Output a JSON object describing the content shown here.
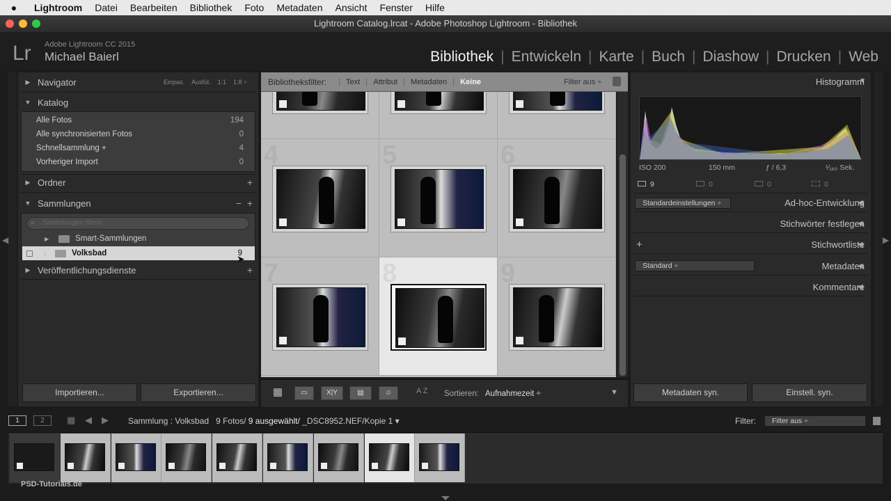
{
  "menubar": {
    "apple": "",
    "items": [
      "Lightroom",
      "Datei",
      "Bearbeiten",
      "Bibliothek",
      "Foto",
      "Metadaten",
      "Ansicht",
      "Fenster",
      "Hilfe"
    ]
  },
  "window": {
    "title": "Lightroom Catalog.lrcat - Adobe Photoshop Lightroom - Bibliothek"
  },
  "identity": {
    "logo": "Lr",
    "product": "Adobe Lightroom CC 2015",
    "user": "Michael Baierl"
  },
  "modules": [
    "Bibliothek",
    "Entwickeln",
    "Karte",
    "Buch",
    "Diashow",
    "Drucken",
    "Web"
  ],
  "navigator": {
    "label": "Navigator",
    "options": [
      "Einpas.",
      "Ausfül.",
      "1:1",
      "1:8 ÷"
    ]
  },
  "katalog": {
    "label": "Katalog",
    "items": [
      {
        "label": "Alle Fotos",
        "count": "194"
      },
      {
        "label": "Alle synchronisierten Fotos",
        "count": "0"
      },
      {
        "label": "Schnellsammlung +",
        "count": "4"
      },
      {
        "label": "Vorheriger Import",
        "count": "0"
      }
    ]
  },
  "ordner": {
    "label": "Ordner",
    "plus": "+"
  },
  "sammlungen": {
    "label": "Sammlungen",
    "minus": "−",
    "plus": "+",
    "search_placeholder": "Sammlungen filtern",
    "items": [
      {
        "label": "Smart-Sammlungen",
        "count": ""
      },
      {
        "label": "Volksbad",
        "count": "9"
      }
    ]
  },
  "veroeffentlichung": {
    "label": "Veröffentlichungsdienste",
    "plus": "+"
  },
  "left_buttons": {
    "import": "Importieren...",
    "export": "Exportieren..."
  },
  "filterbar": {
    "label": "Bibliotheksfilter:",
    "options": [
      "Text",
      "Attribut",
      "Metadaten",
      "Keine"
    ],
    "active": "Keine",
    "filter_preset": "Filter aus ÷"
  },
  "grid": {
    "cells": [
      {
        "num": "",
        "selected": false
      },
      {
        "num": "",
        "selected": false
      },
      {
        "num": "",
        "selected": false
      },
      {
        "num": "4",
        "selected": false
      },
      {
        "num": "5",
        "selected": false
      },
      {
        "num": "6",
        "selected": false
      },
      {
        "num": "7",
        "selected": false
      },
      {
        "num": "8",
        "selected": true
      },
      {
        "num": "9",
        "selected": false
      }
    ]
  },
  "toolbar": {
    "sort_label": "Sortieren:",
    "sort_value": "Aufnahmezeit ÷",
    "az": "A Z",
    "xy": "X|Y"
  },
  "histogram": {
    "label": "Histogramm",
    "iso": "ISO 200",
    "focal": "150 mm",
    "aperture": "ƒ / 6,3",
    "shutter": "¹⁄₁₆₀ Sek.",
    "counts": [
      "9",
      "0",
      "0",
      "0"
    ]
  },
  "adhoc": {
    "preset": "Standardeinstellungen ÷",
    "label": "Ad-hoc-Entwicklung"
  },
  "stichwoerter": {
    "label": "Stichwörter festlegen"
  },
  "stichwortliste": {
    "label": "Stichwortliste",
    "plus": "+"
  },
  "metadaten": {
    "preset": "Standard ÷",
    "label": "Metadaten"
  },
  "kommentare": {
    "label": "Kommentare"
  },
  "right_buttons": {
    "meta_sync": "Metadaten syn.",
    "settings_sync": "Einstell. syn."
  },
  "statusbar": {
    "screen1": "1",
    "screen2": "2",
    "source": "Sammlung : Volksbad",
    "count": "9 Fotos/",
    "selected": "9 ausgewählt/",
    "file": "_DSC8952.NEF/Kopie 1 ▾",
    "filter_label": "Filter:",
    "filter_value": "Filter aus ÷"
  },
  "filmstrip": {
    "selected_index": 7,
    "count": 9
  },
  "watermark": "PSD-Tutorials.de",
  "colors": {
    "accent": "#f2f2f2",
    "grid_bg": "#bcbcbc",
    "selected_cell": "#e8e8e8"
  }
}
